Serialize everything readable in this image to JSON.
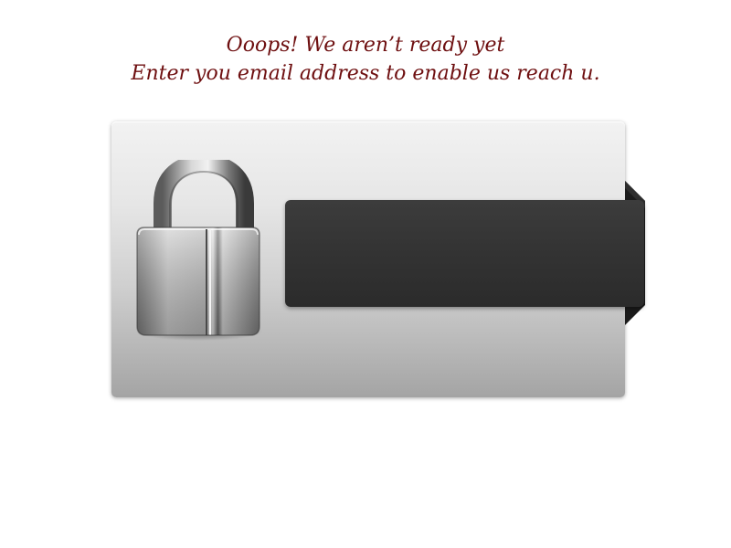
{
  "headline": {
    "line1": "Ooops! We aren’t ready yet",
    "line2": "Enter you email address to enable us reach u."
  },
  "card": {
    "icon": "padlock-icon",
    "email_input": {
      "value": "",
      "placeholder": ""
    }
  },
  "colors": {
    "headline_text": "#6e0f10",
    "band": "#333333",
    "card_top": "#f2f2f2",
    "card_bottom": "#a4a4a4"
  }
}
